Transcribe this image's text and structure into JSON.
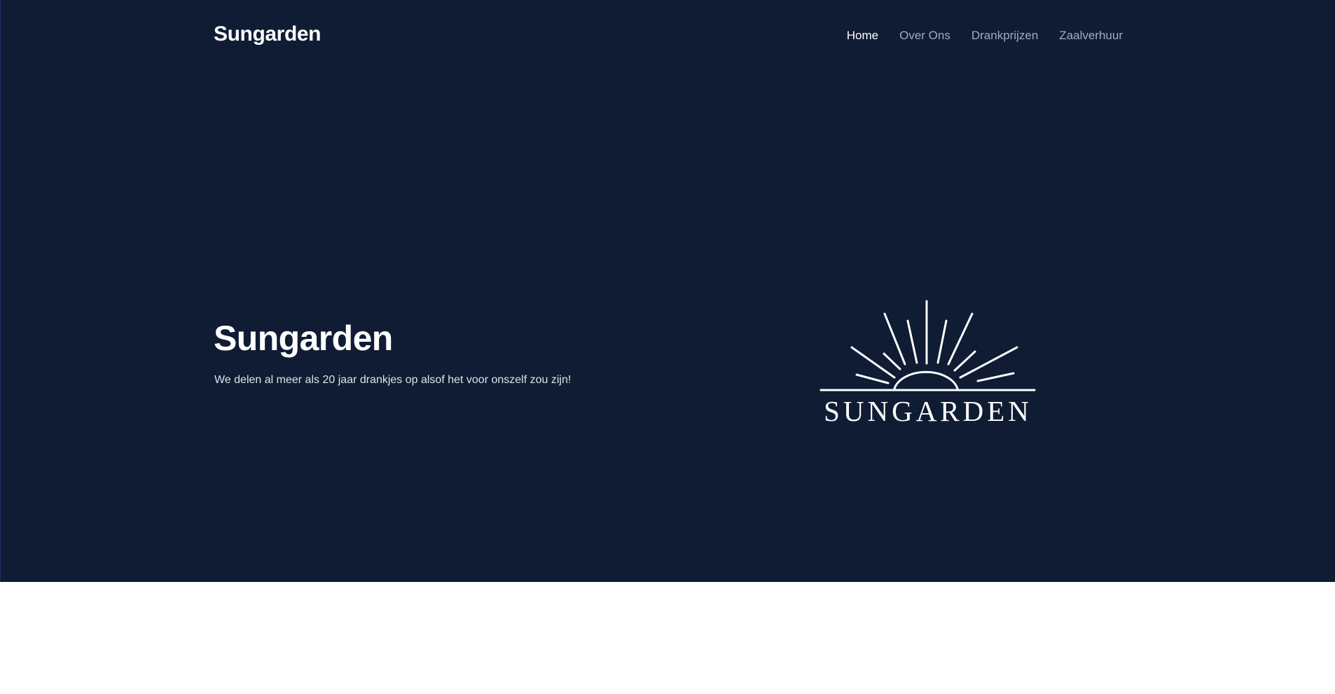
{
  "nav": {
    "brand": "Sungarden",
    "links": [
      {
        "label": "Home",
        "active": true
      },
      {
        "label": "Over Ons",
        "active": false
      },
      {
        "label": "Drankprijzen",
        "active": false
      },
      {
        "label": "Zaalverhuur",
        "active": false
      }
    ]
  },
  "hero": {
    "title": "Sungarden",
    "subtitle": "We delen al meer als 20 jaar drankjes op alsof het voor onszelf zou zijn!",
    "logo_text": "SUNGARDEN"
  },
  "colors": {
    "hero_background": "#0f1c34",
    "nav_link": "#a3acbd",
    "nav_link_active": "#ffffff",
    "text": "#ffffff"
  }
}
